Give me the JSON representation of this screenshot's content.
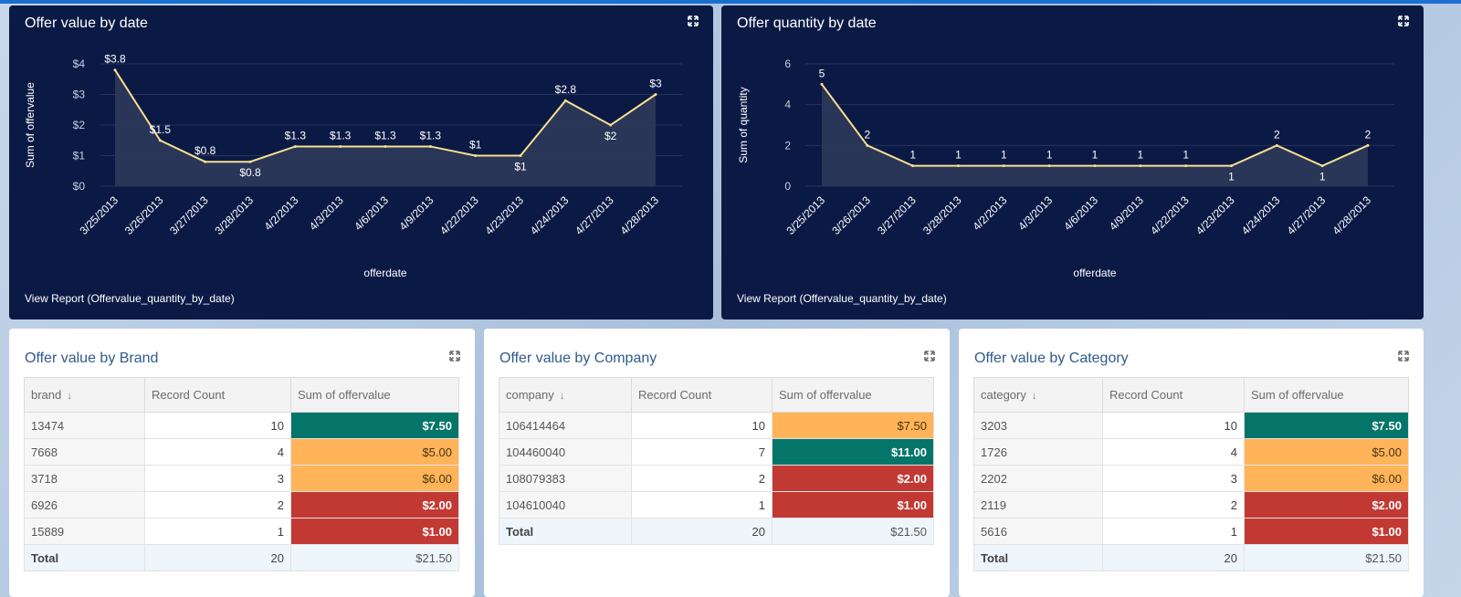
{
  "colors": {
    "panel_dark": "#0b1a45",
    "line": "#f7e08f",
    "area": "#2c3859",
    "green": "#047568",
    "orange": "#ffb459",
    "red": "#c23934"
  },
  "cards": {
    "value_by_date": {
      "title": "Offer value by date",
      "view_report": "View Report (Offervalue_quantity_by_date)"
    },
    "quantity_by_date": {
      "title": "Offer quantity by date",
      "view_report": "View Report (Offervalue_quantity_by_date)"
    },
    "by_brand": {
      "title": "Offer value by Brand",
      "columns": [
        "brand",
        "Record Count",
        "Sum of offervalue"
      ],
      "rows": [
        {
          "key": "13474",
          "count": "10",
          "sum": "$7.50",
          "color": "green"
        },
        {
          "key": "7668",
          "count": "4",
          "sum": "$5.00",
          "color": "orange"
        },
        {
          "key": "3718",
          "count": "3",
          "sum": "$6.00",
          "color": "orange"
        },
        {
          "key": "6926",
          "count": "2",
          "sum": "$2.00",
          "color": "red"
        },
        {
          "key": "15889",
          "count": "1",
          "sum": "$1.00",
          "color": "red"
        }
      ],
      "total": {
        "label": "Total",
        "count": "20",
        "sum": "$21.50"
      }
    },
    "by_company": {
      "title": "Offer value by Company",
      "columns": [
        "company",
        "Record Count",
        "Sum of offervalue"
      ],
      "rows": [
        {
          "key": "106414464",
          "count": "10",
          "sum": "$7.50",
          "color": "orange"
        },
        {
          "key": "104460040",
          "count": "7",
          "sum": "$11.00",
          "color": "green"
        },
        {
          "key": "108079383",
          "count": "2",
          "sum": "$2.00",
          "color": "red"
        },
        {
          "key": "104610040",
          "count": "1",
          "sum": "$1.00",
          "color": "red"
        }
      ],
      "total": {
        "label": "Total",
        "count": "20",
        "sum": "$21.50"
      }
    },
    "by_category": {
      "title": "Offer value by Category",
      "columns": [
        "category",
        "Record Count",
        "Sum of offervalue"
      ],
      "rows": [
        {
          "key": "3203",
          "count": "10",
          "sum": "$7.50",
          "color": "green"
        },
        {
          "key": "1726",
          "count": "4",
          "sum": "$5.00",
          "color": "orange"
        },
        {
          "key": "2202",
          "count": "3",
          "sum": "$6.00",
          "color": "orange"
        },
        {
          "key": "2119",
          "count": "2",
          "sum": "$2.00",
          "color": "red"
        },
        {
          "key": "5616",
          "count": "1",
          "sum": "$1.00",
          "color": "red"
        }
      ],
      "total": {
        "label": "Total",
        "count": "20",
        "sum": "$21.50"
      }
    }
  },
  "chart_data": [
    {
      "type": "area",
      "xlabel": "offerdate",
      "ylabel": "Sum of offervalue",
      "ylim": [
        0,
        4
      ],
      "y_ticks": [
        "$0",
        "$1",
        "$2",
        "$3",
        "$4"
      ],
      "categories": [
        "3/25/2013",
        "3/26/2013",
        "3/27/2013",
        "3/28/2013",
        "4/2/2013",
        "4/3/2013",
        "4/6/2013",
        "4/9/2013",
        "4/22/2013",
        "4/23/2013",
        "4/24/2013",
        "4/27/2013",
        "4/28/2013"
      ],
      "values": [
        3.8,
        1.5,
        0.8,
        0.8,
        1.3,
        1.3,
        1.3,
        1.3,
        1,
        1,
        2.8,
        2,
        3
      ],
      "labels": [
        "$3.8",
        "$1.5",
        "$0.8",
        "$0.8",
        "$1.3",
        "$1.3",
        "$1.3",
        "$1.3",
        "$1",
        "$1",
        "$2.8",
        "$2",
        "$3"
      ],
      "grid": true
    },
    {
      "type": "area",
      "xlabel": "offerdate",
      "ylabel": "Sum of quantity",
      "ylim": [
        0,
        6
      ],
      "y_ticks": [
        "0",
        "2",
        "4",
        "6"
      ],
      "categories": [
        "3/25/2013",
        "3/26/2013",
        "3/27/2013",
        "3/28/2013",
        "4/2/2013",
        "4/3/2013",
        "4/6/2013",
        "4/9/2013",
        "4/22/2013",
        "4/23/2013",
        "4/24/2013",
        "4/27/2013",
        "4/28/2013"
      ],
      "values": [
        5,
        2,
        1,
        1,
        1,
        1,
        1,
        1,
        1,
        1,
        2,
        1,
        2
      ],
      "labels": [
        "5",
        "2",
        "1",
        "1",
        "1",
        "1",
        "1",
        "1",
        "1",
        "1",
        "2",
        "1",
        "2"
      ],
      "grid": true
    }
  ]
}
